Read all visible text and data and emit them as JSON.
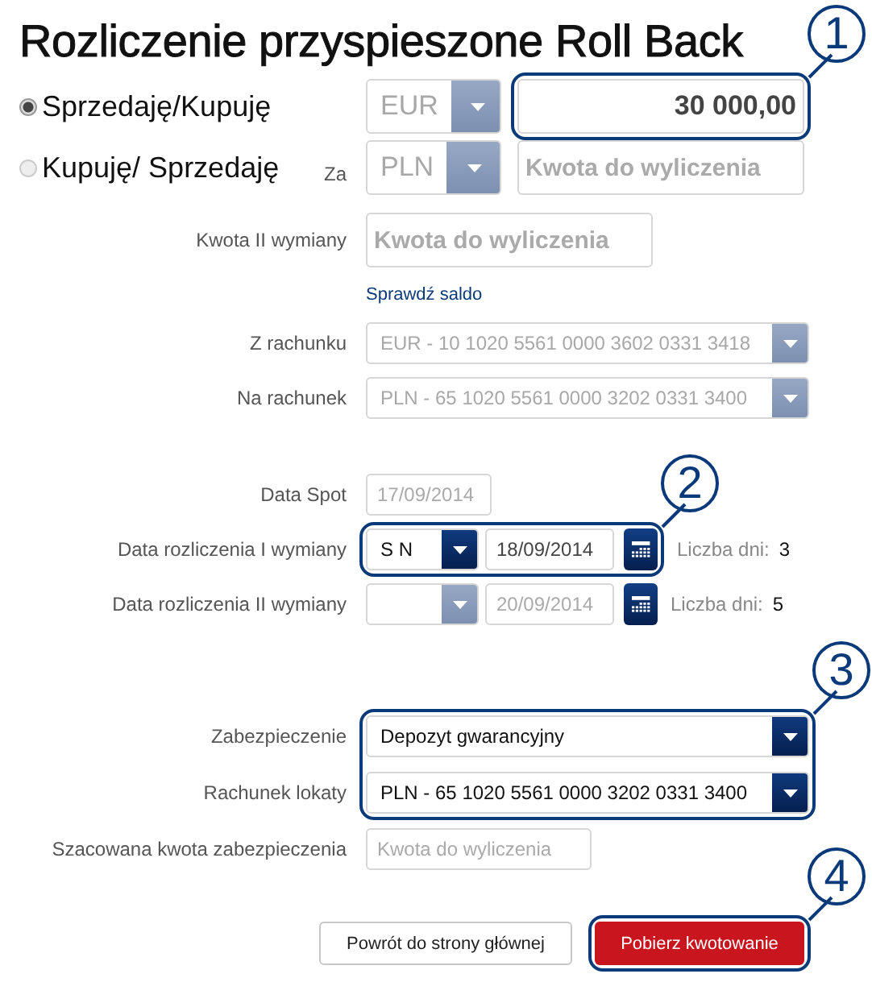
{
  "title": "Rozliczenie przyspieszone Roll Back",
  "directions": [
    {
      "label": "Sprzedaję/Kupuję",
      "selected": true
    },
    {
      "label": "Kupuję/ Sprzedaję",
      "selected": false
    }
  ],
  "currency_1": {
    "value": "EUR",
    "disabled": true
  },
  "amount_1": {
    "value": "30 000,00",
    "callout": "1"
  },
  "za_label": "Za",
  "currency_2": {
    "value": "PLN",
    "disabled": true
  },
  "amount_2": {
    "placeholder": "Kwota do wyliczenia"
  },
  "second_amount": {
    "label": "Kwota II wymiany",
    "placeholder": "Kwota do wyliczenia"
  },
  "check_balance_link": "Sprawdź saldo",
  "accounts": [
    {
      "label": "Z rachunku",
      "value": "EUR - 10 1020 5561 0000 3602 0331 3418",
      "disabled": true
    },
    {
      "label": "Na rachunek",
      "value": "PLN - 65 1020 5561 0000 3202 0331 3400",
      "disabled": true
    }
  ],
  "spot": {
    "label": "Data Spot",
    "value": "17/09/2014",
    "disabled": true
  },
  "settlements": [
    {
      "label": "Data rozliczenia I wymiany",
      "tenor": "S N",
      "date": "18/09/2014",
      "disabled": false,
      "days_label": "Liczba dni:",
      "days": "3",
      "callout": "2"
    },
    {
      "label": "Data rozliczenia II wymiany",
      "date": "20/09/2014",
      "disabled": true,
      "days_label": "Liczba dni:",
      "days": "5"
    }
  ],
  "collateral": {
    "callout": "3",
    "fields": [
      {
        "label": "Zabezpieczenie",
        "value": "Depozyt gwarancyjny",
        "disabled": false
      },
      {
        "label": "Rachunek lokaty",
        "value": "PLN - 65 1020 5561 0000 3202 0331 3400",
        "disabled": false
      }
    ]
  },
  "estimated": {
    "label": "Szacowana kwota zabezpieczenia",
    "placeholder": "Kwota do wyliczenia"
  },
  "buttons": [
    {
      "label": "Powrót do strony głównej",
      "kind": "secondary"
    },
    {
      "label": "Pobierz kwotowanie",
      "kind": "primary",
      "callout": "4"
    }
  ]
}
